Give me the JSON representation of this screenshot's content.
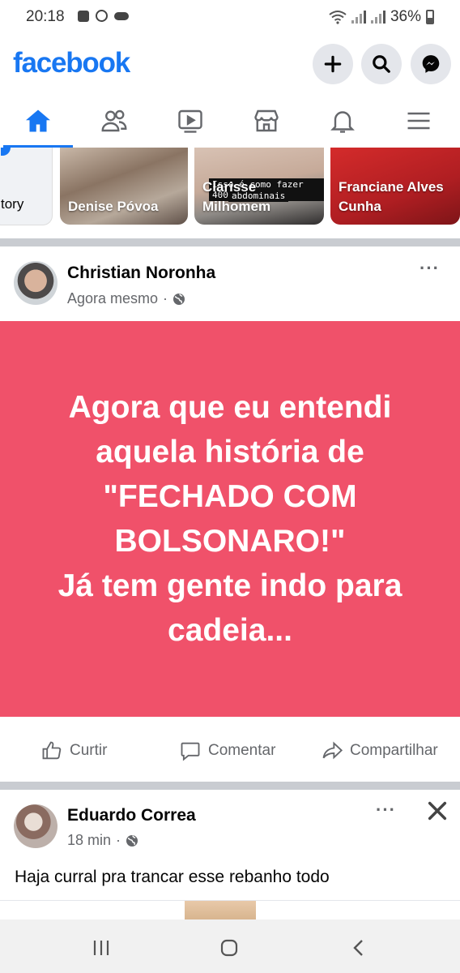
{
  "status_bar": {
    "time": "20:18",
    "battery": "36%"
  },
  "header": {
    "logo": "facebook"
  },
  "stories": [
    {
      "name": "tory"
    },
    {
      "name": "Denise Póvoa"
    },
    {
      "name": "Clarisse Milhomem",
      "caption_line1": "Isso é como fazer 400",
      "caption_line2": "abdominais"
    },
    {
      "name": "Franciane Alves Cunha"
    }
  ],
  "post1": {
    "author": "Christian Noronha",
    "time": "Agora mesmo",
    "more": "···",
    "background_color": "#f0516a",
    "text": "Agora que eu entendi\naquela história de\n\"FECHADO COM\nBOLSONARO!\"\nJá tem gente indo para\ncadeia...",
    "actions": {
      "like": "Curtir",
      "comment": "Comentar",
      "share": "Compartilhar"
    }
  },
  "post2": {
    "author": "Eduardo Correa",
    "time": "18 min",
    "more": "···",
    "text": "Haja curral pra trancar esse rebanho todo"
  },
  "colors": {
    "brand": "#1877f2",
    "post_bg": "#f0516a",
    "secondary_text": "#65676b"
  },
  "icons": [
    "plus-icon",
    "search-icon",
    "messenger-icon",
    "home-icon",
    "friends-icon",
    "watch-icon",
    "marketplace-icon",
    "bell-icon",
    "menu-icon",
    "like-icon",
    "comment-icon",
    "share-icon",
    "globe-icon",
    "close-icon",
    "recents-icon",
    "home-button-icon",
    "back-icon"
  ]
}
